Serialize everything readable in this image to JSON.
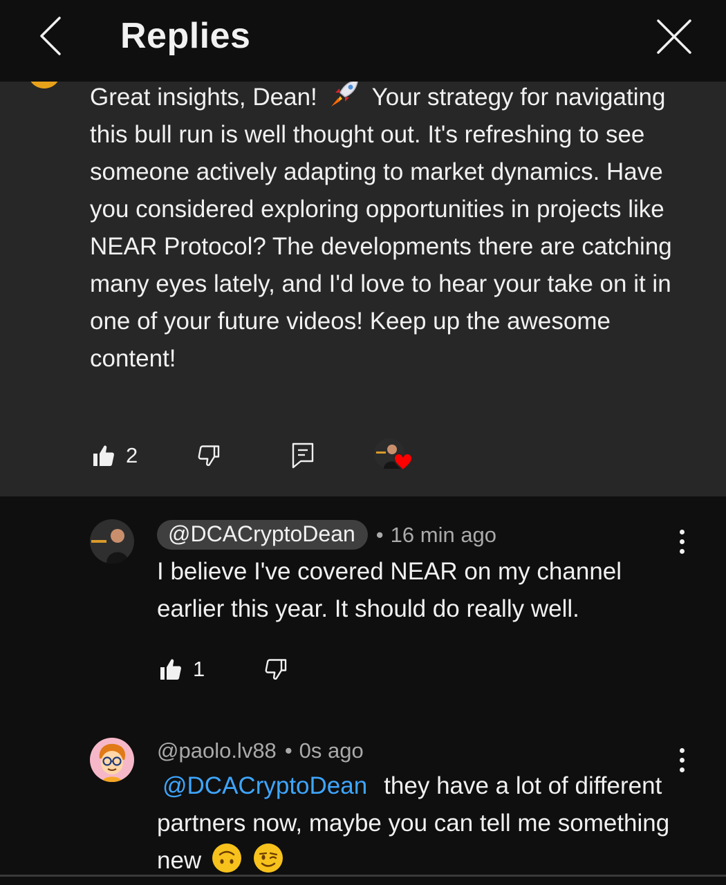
{
  "header": {
    "title": "Replies"
  },
  "parent_comment": {
    "text_before_emoji": "Great insights, Dean!",
    "text_after_emoji": " Your strategy for navigating this bull run is well thought out. It's refreshing to see someone actively adapting to market dynamics. Have you considered exploring opportunities in projects like NEAR Protocol? The developments there are catching many eyes lately, and I'd love to hear your take on it in one of your future videos! Keep up the awesome content!",
    "like_count": "2"
  },
  "replies": [
    {
      "author": "@DCACryptoDean",
      "time": "16 min ago",
      "text": "I believe I've covered NEAR on my channel earlier this year. It should do really well.",
      "like_count": "1"
    },
    {
      "author": "@paolo.lv88",
      "time": "0s ago",
      "mention": "@DCACryptoDean",
      "text": "they have a lot of different partners now, maybe you can tell me something new"
    }
  ],
  "colors": {
    "background": "#0f0f0f",
    "card": "#272727",
    "mention": "#3ea6ff",
    "heart": "#ff0000"
  }
}
